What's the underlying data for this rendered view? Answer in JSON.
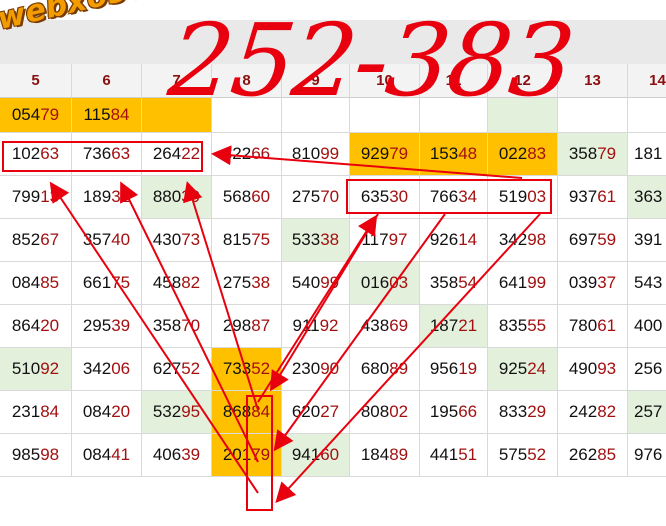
{
  "watermark": "webxoso.net",
  "handwriting": "252-383",
  "columns": [
    "5",
    "6",
    "7",
    "8",
    "9",
    "10",
    "11",
    "12",
    "13",
    "14"
  ],
  "rows": [
    [
      "05479",
      "11584",
      "",
      "",
      "",
      "",
      "",
      "",
      "",
      ""
    ],
    [
      "10263",
      "73663",
      "26422",
      "82266",
      "81099",
      "92979",
      "15348",
      "02283",
      "35879",
      "181"
    ],
    [
      "79913",
      "18932",
      "88039",
      "56860",
      "27570",
      "63530",
      "76634",
      "51903",
      "93761",
      "363"
    ],
    [
      "85267",
      "35740",
      "43073",
      "81575",
      "53338",
      "11797",
      "92614",
      "34298",
      "69759",
      "391"
    ],
    [
      "08485",
      "66175",
      "45882",
      "27538",
      "54099",
      "01603",
      "35854",
      "64199",
      "03937",
      "543"
    ],
    [
      "86420",
      "29539",
      "35870",
      "29887",
      "91192",
      "43869",
      "18721",
      "83555",
      "78061",
      "400"
    ],
    [
      "51092",
      "34206",
      "62752",
      "73352",
      "23090",
      "68089",
      "95619",
      "92524",
      "49093",
      "256"
    ],
    [
      "23184",
      "08420",
      "53295",
      "86884",
      "62027",
      "80802",
      "19566",
      "83329",
      "24282",
      "257"
    ],
    [
      "98598",
      "08441",
      "40639",
      "20179",
      "94160",
      "18489",
      "44151",
      "57552",
      "26285",
      "976"
    ]
  ],
  "colors": {
    "highlight": "#ffc000",
    "light_green": "#e3f1dc",
    "annotation_red": "#e8000e",
    "digit_red": "#a31010"
  }
}
